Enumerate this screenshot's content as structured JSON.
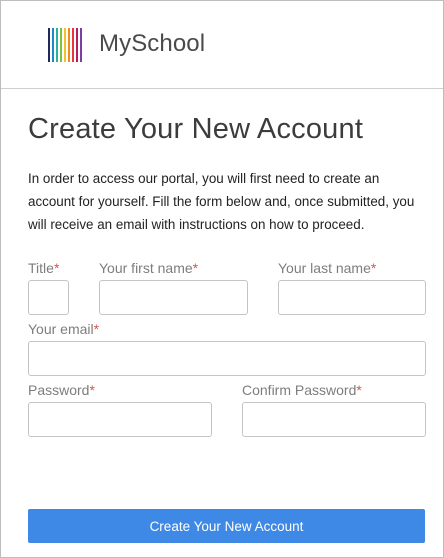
{
  "brand": {
    "name": "MySchool",
    "logo_icon": "striped-bars-logo",
    "logo_colors": [
      "#1f2a5a",
      "#1e88c8",
      "#2ab0a8",
      "#7cc242",
      "#f2c12e",
      "#f08a24",
      "#e53935",
      "#c2185b",
      "#7b3fa0"
    ]
  },
  "page": {
    "title": "Create Your New Account",
    "intro": "In order to access our portal, you will first need to create an account for yourself. Fill the form below and, once submitted, you will receive an email with instructions on how to proceed."
  },
  "form": {
    "required_marker": "*",
    "title_label": "Title",
    "title_value": "",
    "first_name_label": "Your first name",
    "first_name_value": "",
    "last_name_label": "Your last name",
    "last_name_value": "",
    "email_label": "Your email",
    "email_value": "",
    "password_label": "Password",
    "confirm_password_label": "Confirm Password",
    "submit_label": "Create Your New Account"
  },
  "colors": {
    "accent": "#3e88e6",
    "required": "#d9534f"
  }
}
